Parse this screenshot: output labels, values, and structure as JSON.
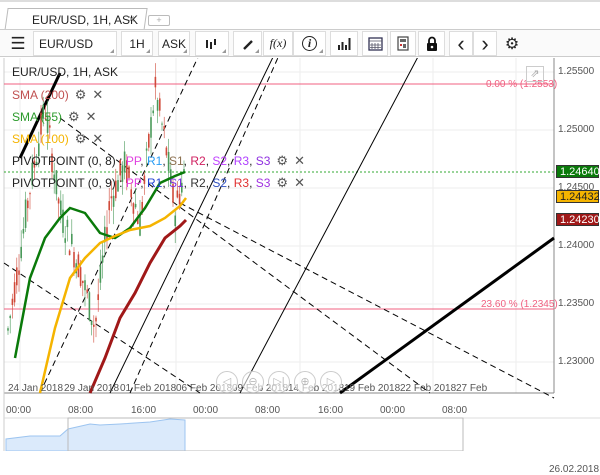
{
  "tab": {
    "title": "EUR/USD, 1H, ASK",
    "close": "×",
    "add": "+"
  },
  "toolbar": {
    "menu": "☰",
    "symbol": "EUR/USD",
    "period": "1H",
    "side": "ASK",
    "fx": "f(x)",
    "info": "i",
    "prev": "‹",
    "next": "›",
    "settings": "⚙"
  },
  "legend": {
    "title": "EUR/USD, 1H, ASK",
    "sma200": "SMA (200)",
    "sma55": "SMA (55)",
    "sma100": "SMA (100)",
    "pivot1": "PIVOTPOINT (0, 8)",
    "pivot2": "PIVOTPOINT (0, 9)",
    "sep": " : ",
    "comma": ", ",
    "pivot1_items": [
      {
        "t": "PP",
        "c": "#e040e0"
      },
      {
        "t": "R1",
        "c": "#2a9df4"
      },
      {
        "t": "S1",
        "c": "#8b6f4e"
      },
      {
        "t": "R2",
        "c": "#d02060"
      },
      {
        "t": "S2",
        "c": "#c040ff"
      },
      {
        "t": "R3",
        "c": "#b040ff"
      },
      {
        "t": "S3",
        "c": "#9030e0"
      }
    ],
    "pivot2_items": [
      {
        "t": "PP",
        "c": "#e040e0"
      },
      {
        "t": "R1",
        "c": "#2040d0"
      },
      {
        "t": "S1",
        "c": "#8030e0"
      },
      {
        "t": "R2",
        "c": "#333333"
      },
      {
        "t": "S2",
        "c": "#3050c0"
      },
      {
        "t": "R3",
        "c": "#e03030"
      },
      {
        "t": "S3",
        "c": "#a030e0"
      }
    ],
    "gear": "⚙",
    "close": "✕"
  },
  "fib": {
    "top": "0.00 % (1.2553)",
    "mid": "23.60 % (1.2345)"
  },
  "price_axis": [
    "1.25500",
    "1.25000",
    "1.24500",
    "1.24000",
    "1.23500",
    "1.23000"
  ],
  "price_labels": [
    {
      "v": "1.24640",
      "c": "#0a7a0a"
    },
    {
      "v": "1.24432",
      "c": "#f5b400"
    },
    {
      "v": "1.24230",
      "c": "#a01818"
    }
  ],
  "dates": [
    "24 Jan 2018",
    "29 Jan 2018",
    "01 Feb 2018",
    "06 Feb 2018",
    "09 Feb 2018",
    "14 Feb 2018",
    "19 Feb 2018",
    "22 Feb 2018",
    "27 Feb"
  ],
  "times": [
    "00:00",
    "08:00",
    "16:00",
    "00:00",
    "08:00",
    "16:00",
    "00:00",
    "08:00"
  ],
  "nav_date": "26.02.2018",
  "nav_buttons": [
    "◁",
    "⊖",
    "▷|",
    "⊕",
    "▷"
  ],
  "colors": {
    "sma200": "#a01818",
    "sma55": "#0a7a0a",
    "sma100": "#f5b400",
    "fib": "#f06080"
  }
}
